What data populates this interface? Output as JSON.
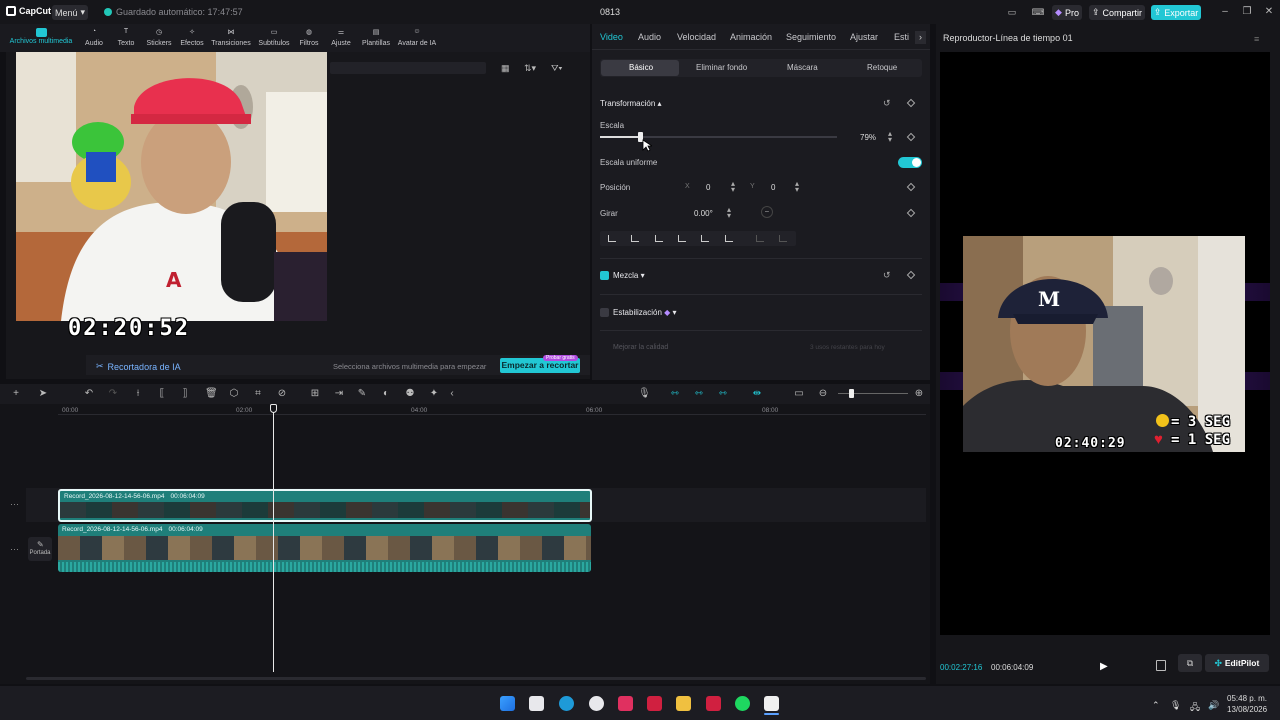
{
  "app": {
    "logo_text": "CapCut",
    "menu_label": "Menú",
    "autosave": "Guardado automático: 17:47:57",
    "project_name": "0813",
    "pro_label": "Pro",
    "share_label": "Compartir",
    "export_label": "Exportar"
  },
  "media_toolbar": {
    "items": [
      "Archivos multimedia",
      "Audio",
      "Texto",
      "Stickers",
      "Efectos",
      "Transiciones",
      "Subtítulos",
      "Filtros",
      "Ajuste",
      "Plantillas",
      "Avatar de IA"
    ]
  },
  "media_panel": {
    "webcam_clock": "02:20:52",
    "ai_recorder": "Recortadora de IA",
    "ai_hint": "Selecciona archivos multimedia para empezar",
    "ai_button": "Empezar a recortar",
    "ai_badge": "Probar gratis"
  },
  "inspector": {
    "tabs": [
      "Video",
      "Audio",
      "Velocidad",
      "Animación",
      "Seguimiento",
      "Ajustar",
      "Esti"
    ],
    "subtabs": [
      "Básico",
      "Eliminar fondo",
      "Máscara",
      "Retoque"
    ],
    "transform_label": "Transformación",
    "scale_label": "Escala",
    "scale_value": "79%",
    "scale_fraction": 0.17,
    "uniform_scale_label": "Escala uniforme",
    "position_label": "Posición",
    "pos_x_label": "X",
    "pos_x": "0",
    "pos_y_label": "Y",
    "pos_y": "0",
    "rotate_label": "Girar",
    "rotate_value": "0.00°",
    "blend_label": "Mezcla",
    "stabilize_label": "Estabilización",
    "enhance_label": "Mejorar la calidad",
    "enhance_hint": "3 usos restantes para hoy"
  },
  "player": {
    "title": "Reproductor-Línea de tiempo 01",
    "overlay_clock": "02:40:29",
    "overlay_line1": "= 3 SEG",
    "overlay_line2": "= 1 SEG",
    "current_time": "00:02:27:16",
    "total_time": "00:06:04:09",
    "editpilot": "EditPilot"
  },
  "timeline": {
    "ruler": [
      "00:00",
      "02:00",
      "04:00",
      "06:00",
      "08:00"
    ],
    "clip1_name": "Record_2026-08-12-14-56-06.mp4",
    "clip1_duration": "00:06:04:09",
    "clip2_name": "Record_2026-08-12-14-56-06.mp4",
    "clip2_duration": "00:06:04:09",
    "cover_label": "Portada"
  },
  "taskbar": {
    "time": "05:48 p. m.",
    "date": "13/08/2026"
  },
  "colors": {
    "accent": "#22c7d4",
    "clip_teal": "#1f7f7a"
  }
}
